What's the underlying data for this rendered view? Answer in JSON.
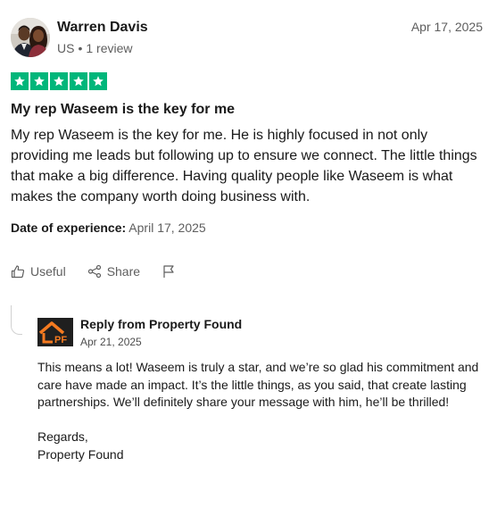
{
  "reviewer": {
    "name": "Warren Davis",
    "country": "US",
    "separator": "•",
    "review_count": "1 review"
  },
  "review": {
    "date": "Apr 17, 2025",
    "rating": 5,
    "rating_color": "#00b67a",
    "title": "My rep Waseem is the key for me",
    "body": "My rep Waseem is the key for me. He is highly focused in not only providing me leads but following up to ensure we connect. The little things that make a big difference. Having quality people like Waseem is what makes the company worth doing business with.",
    "experience_label": "Date of experience:",
    "experience_date": "April 17, 2025"
  },
  "actions": {
    "useful_label": "Useful",
    "share_label": "Share",
    "useful_icon": "thumbs-up-icon",
    "share_icon": "share-icon",
    "report_icon": "flag-icon"
  },
  "reply": {
    "title": "Reply from Property Found",
    "date": "Apr 21, 2025",
    "logo_text": "PF",
    "logo_accent": "#f47a20",
    "body": "This means a lot! Waseem is truly a star, and we’re so glad his commitment and care have made an impact. It’s the little things, as you said, that create lasting partnerships. We’ll definitely share your message with him, he’ll be thrilled!",
    "sign_off": "Regards,",
    "signature": "Property Found"
  }
}
